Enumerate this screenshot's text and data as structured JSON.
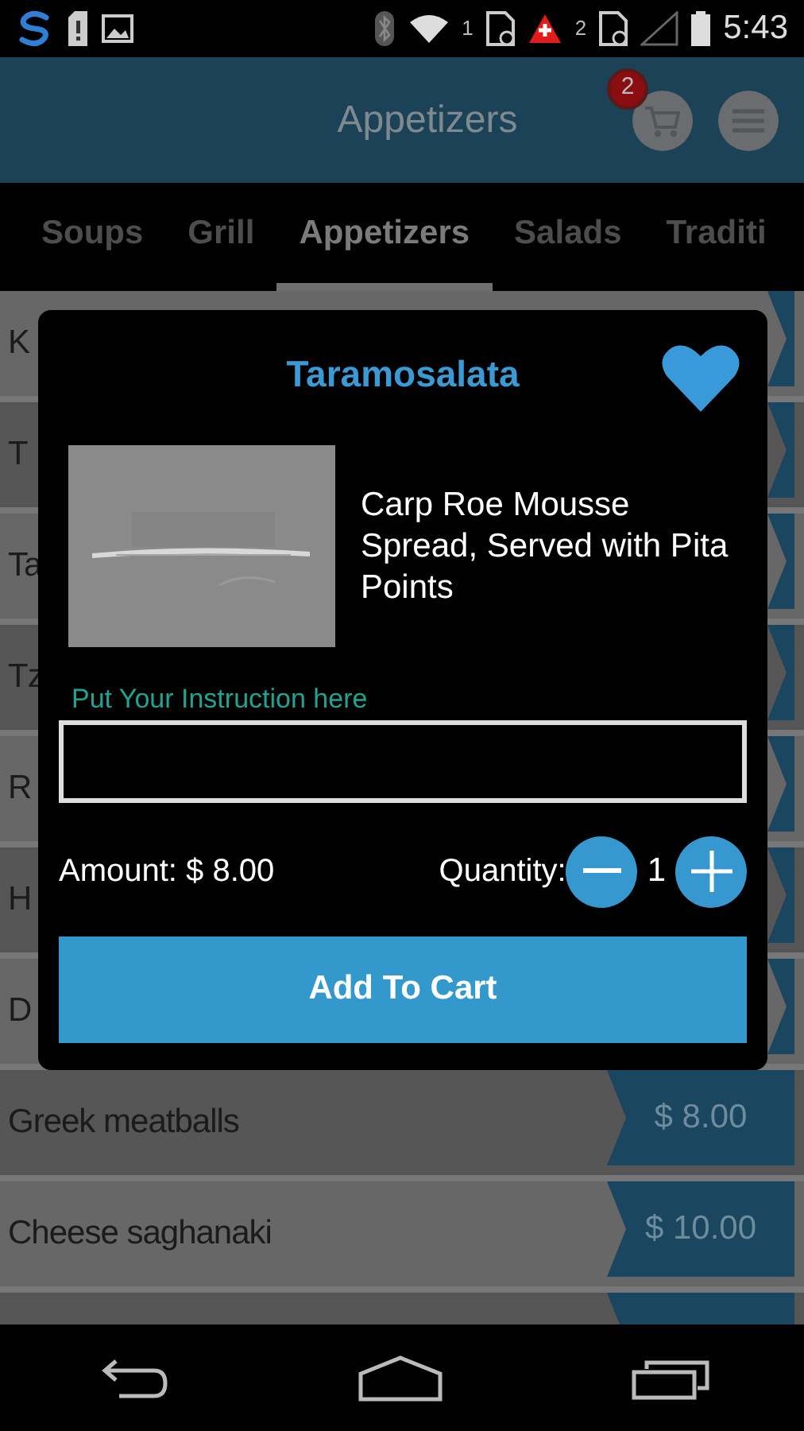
{
  "status_bar": {
    "sim_slots": [
      "1",
      "2"
    ],
    "time": "5:43"
  },
  "app_bar": {
    "title": "Appetizers",
    "cart_count": "2"
  },
  "tabs": [
    {
      "label": "Soups",
      "selected": false
    },
    {
      "label": "Grill",
      "selected": false
    },
    {
      "label": "Appetizers",
      "selected": true
    },
    {
      "label": "Salads",
      "selected": false
    },
    {
      "label": "Traditi",
      "selected": false
    }
  ],
  "menu_items": [
    {
      "name": "K"
    },
    {
      "name": "T"
    },
    {
      "name": "Ta"
    },
    {
      "name": "Tz"
    },
    {
      "name": "R"
    },
    {
      "name": "H"
    },
    {
      "name": "D"
    },
    {
      "name": "Greek meatballs",
      "price": "$ 8.00"
    },
    {
      "name": "Cheese saghanaki",
      "price": "$ 10.00"
    }
  ],
  "dialog": {
    "title": "Taramosalata",
    "favorite": true,
    "description": "Carp Roe Mousse Spread, Served with Pita Points",
    "instruction_label": "Put Your Instruction here",
    "amount": "Amount: $ 8.00",
    "quantity_label": "Quantity:",
    "quantity": "1",
    "button": "Add To Cart"
  }
}
